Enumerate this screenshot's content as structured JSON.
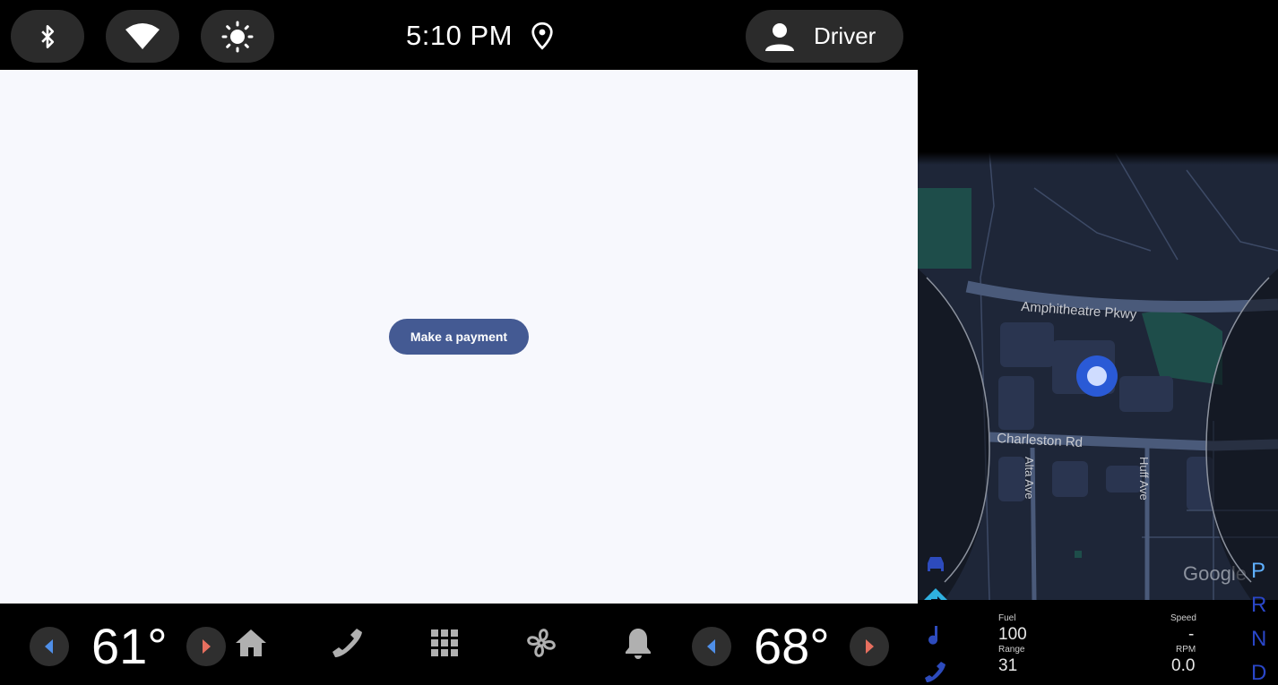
{
  "status_bar": {
    "time": "5:10 PM",
    "user_name": "Driver",
    "icons": [
      "bluetooth-icon",
      "wifi-icon",
      "brightness-icon",
      "location-pin-icon",
      "person-icon"
    ]
  },
  "app": {
    "make_payment_label": "Make a payment",
    "background_color": "#f7f8fd",
    "button_color": "#445a93"
  },
  "bottom_bar": {
    "driver_temp": "61°",
    "passenger_temp": "68°",
    "nav_icons": [
      "home-icon",
      "phone-icon",
      "apps-grid-icon",
      "fan-icon",
      "bell-icon"
    ]
  },
  "cluster": {
    "map": {
      "roads": [
        "Amphitheatre Pkwy",
        "Charleston Rd",
        "Alta Ave",
        "Huff Ave"
      ],
      "attribution": "Google"
    },
    "fuel_label": "Fuel",
    "fuel_value": "100",
    "range_label": "Range",
    "range_value": "31",
    "speed_label": "Speed",
    "speed_value": "-",
    "rpm_label": "RPM",
    "rpm_value": "0.0",
    "gears": [
      "P",
      "R",
      "N",
      "D"
    ],
    "active_gear": "P",
    "side_icons": [
      "car-icon",
      "directions-icon",
      "music-note-icon",
      "phone-icon"
    ]
  }
}
